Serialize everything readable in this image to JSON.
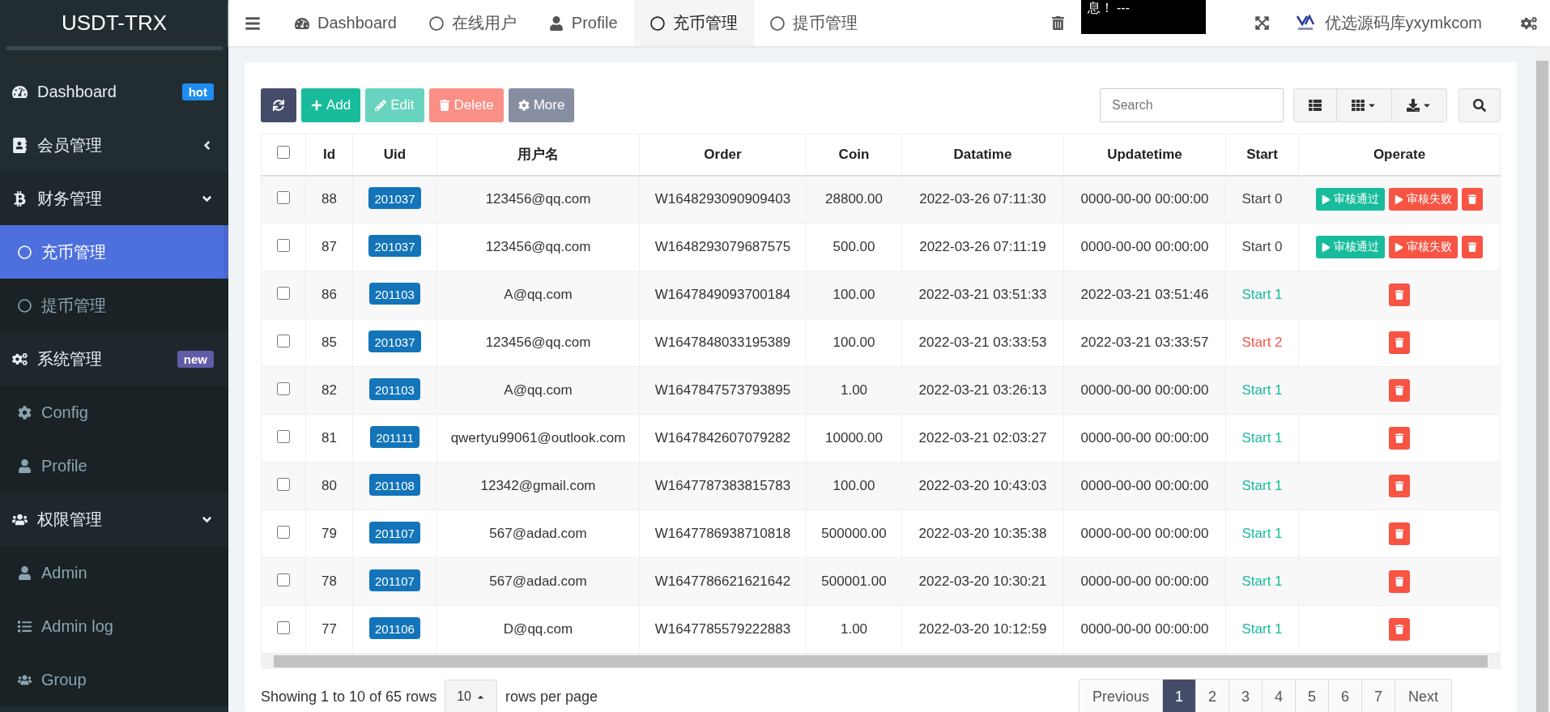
{
  "sidebar": {
    "brand": "USDT-TRX",
    "items": [
      {
        "kind": "link",
        "label": "Dashboard",
        "selected": false,
        "badge": {
          "text": "hot",
          "color": "#1e8cf0"
        }
      },
      {
        "kind": "menu",
        "label": "会员管理",
        "selected": false,
        "expanded": false
      },
      {
        "kind": "menu",
        "label": "财务管理",
        "selected": false,
        "expanded": true,
        "children": [
          {
            "label": "充币管理",
            "selected": true
          },
          {
            "label": "提币管理",
            "selected": false
          }
        ]
      },
      {
        "kind": "menu",
        "label": "系统管理",
        "selected": false,
        "expanded": true,
        "badge": {
          "text": "new",
          "color": "#605ca8"
        },
        "children": [
          {
            "label": "Config",
            "selected": false
          },
          {
            "label": "Profile",
            "selected": false
          }
        ]
      },
      {
        "kind": "menu",
        "label": "权限管理",
        "selected": false,
        "expanded": true,
        "children": [
          {
            "label": "Admin",
            "selected": false
          },
          {
            "label": "Admin log",
            "selected": false
          },
          {
            "label": "Group",
            "selected": false
          }
        ]
      }
    ]
  },
  "topnav": {
    "tabs": [
      {
        "label": "Dashboard",
        "selected": false
      },
      {
        "label": "在线用户",
        "selected": false
      },
      {
        "label": "Profile",
        "selected": false
      },
      {
        "label": "充币管理",
        "selected": true
      },
      {
        "label": "提币管理",
        "selected": false
      }
    ],
    "notice": "息！ ---",
    "site_name": "优选源码库yxymkcom"
  },
  "toolbar": {
    "buttons": [
      {
        "kind": "refresh",
        "disabled": false
      },
      {
        "kind": "add",
        "label": "Add",
        "disabled": false
      },
      {
        "kind": "edit",
        "label": "Edit",
        "disabled": true
      },
      {
        "kind": "delete",
        "label": "Delete",
        "disabled": true
      },
      {
        "kind": "more",
        "label": "More",
        "disabled": false
      }
    ],
    "search": {
      "placeholder": "Search"
    }
  },
  "table": {
    "select_all": {
      "checked": false
    },
    "columns": [
      "Id",
      "Uid",
      "用户名",
      "Order",
      "Coin",
      "Datatime",
      "Updatetime",
      "Start",
      "Operate"
    ],
    "rows": [
      {
        "checked": false,
        "id": "88",
        "uid": "201037",
        "username": "123456@qq.com",
        "order": "W1648293090909403",
        "coin": "28800.00",
        "datatime": "2022-03-26 07:11:30",
        "updatetime": "0000-00-00 00:00:00",
        "status": {
          "text": "Start 0",
          "kind": "pending"
        },
        "actions": [
          {
            "kind": "approve",
            "label": "审核通过"
          },
          {
            "kind": "reject",
            "label": "审核失败"
          },
          {
            "kind": "delete"
          }
        ]
      },
      {
        "checked": false,
        "id": "87",
        "uid": "201037",
        "username": "123456@qq.com",
        "order": "W1648293079687575",
        "coin": "500.00",
        "datatime": "2022-03-26 07:11:19",
        "updatetime": "0000-00-00 00:00:00",
        "status": {
          "text": "Start 0",
          "kind": "pending"
        },
        "actions": [
          {
            "kind": "approve",
            "label": "审核通过"
          },
          {
            "kind": "reject",
            "label": "审核失败"
          },
          {
            "kind": "delete"
          }
        ]
      },
      {
        "checked": false,
        "id": "86",
        "uid": "201103",
        "username": "A@qq.com",
        "order": "W1647849093700184",
        "coin": "100.00",
        "datatime": "2022-03-21 03:51:33",
        "updatetime": "2022-03-21 03:51:46",
        "status": {
          "text": "Start 1",
          "kind": "success"
        },
        "actions": [
          {
            "kind": "delete"
          }
        ]
      },
      {
        "checked": false,
        "id": "85",
        "uid": "201037",
        "username": "123456@qq.com",
        "order": "W1647848033195389",
        "coin": "100.00",
        "datatime": "2022-03-21 03:33:53",
        "updatetime": "2022-03-21 03:33:57",
        "status": {
          "text": "Start 2",
          "kind": "failed"
        },
        "actions": [
          {
            "kind": "delete"
          }
        ]
      },
      {
        "checked": false,
        "id": "82",
        "uid": "201103",
        "username": "A@qq.com",
        "order": "W1647847573793895",
        "coin": "1.00",
        "datatime": "2022-03-21 03:26:13",
        "updatetime": "0000-00-00 00:00:00",
        "status": {
          "text": "Start 1",
          "kind": "success"
        },
        "actions": [
          {
            "kind": "delete"
          }
        ]
      },
      {
        "checked": false,
        "id": "81",
        "uid": "201111",
        "username": "qwertyu99061@outlook.com",
        "order": "W1647842607079282",
        "coin": "10000.00",
        "datatime": "2022-03-21 02:03:27",
        "updatetime": "0000-00-00 00:00:00",
        "status": {
          "text": "Start 1",
          "kind": "success"
        },
        "actions": [
          {
            "kind": "delete"
          }
        ]
      },
      {
        "checked": false,
        "id": "80",
        "uid": "201108",
        "username": "12342@gmail.com",
        "order": "W1647787383815783",
        "coin": "100.00",
        "datatime": "2022-03-20 10:43:03",
        "updatetime": "0000-00-00 00:00:00",
        "status": {
          "text": "Start 1",
          "kind": "success"
        },
        "actions": [
          {
            "kind": "delete"
          }
        ]
      },
      {
        "checked": false,
        "id": "79",
        "uid": "201107",
        "username": "567@adad.com",
        "order": "W1647786938710818",
        "coin": "500000.00",
        "datatime": "2022-03-20 10:35:38",
        "updatetime": "0000-00-00 00:00:00",
        "status": {
          "text": "Start 1",
          "kind": "success"
        },
        "actions": [
          {
            "kind": "delete"
          }
        ]
      },
      {
        "checked": false,
        "id": "78",
        "uid": "201107",
        "username": "567@adad.com",
        "order": "W1647786621621642",
        "coin": "500001.00",
        "datatime": "2022-03-20 10:30:21",
        "updatetime": "0000-00-00 00:00:00",
        "status": {
          "text": "Start 1",
          "kind": "success"
        },
        "actions": [
          {
            "kind": "delete"
          }
        ]
      },
      {
        "checked": false,
        "id": "77",
        "uid": "201106",
        "username": "D@qq.com",
        "order": "W1647785579222883",
        "coin": "1.00",
        "datatime": "2022-03-20 10:12:59",
        "updatetime": "0000-00-00 00:00:00",
        "status": {
          "text": "Start 1",
          "kind": "success"
        },
        "actions": [
          {
            "kind": "delete"
          }
        ]
      }
    ]
  },
  "footer": {
    "summary": "Showing 1 to 10 of 65 rows",
    "page_size": "10",
    "page_size_suffix": "rows per page",
    "pagination": {
      "previous": "Previous",
      "next": "Next",
      "pages": [
        {
          "label": "1",
          "selected": true
        },
        {
          "label": "2",
          "selected": false
        },
        {
          "label": "3",
          "selected": false
        },
        {
          "label": "4",
          "selected": false
        },
        {
          "label": "5",
          "selected": false
        },
        {
          "label": "6",
          "selected": false
        },
        {
          "label": "7",
          "selected": false
        }
      ]
    }
  }
}
